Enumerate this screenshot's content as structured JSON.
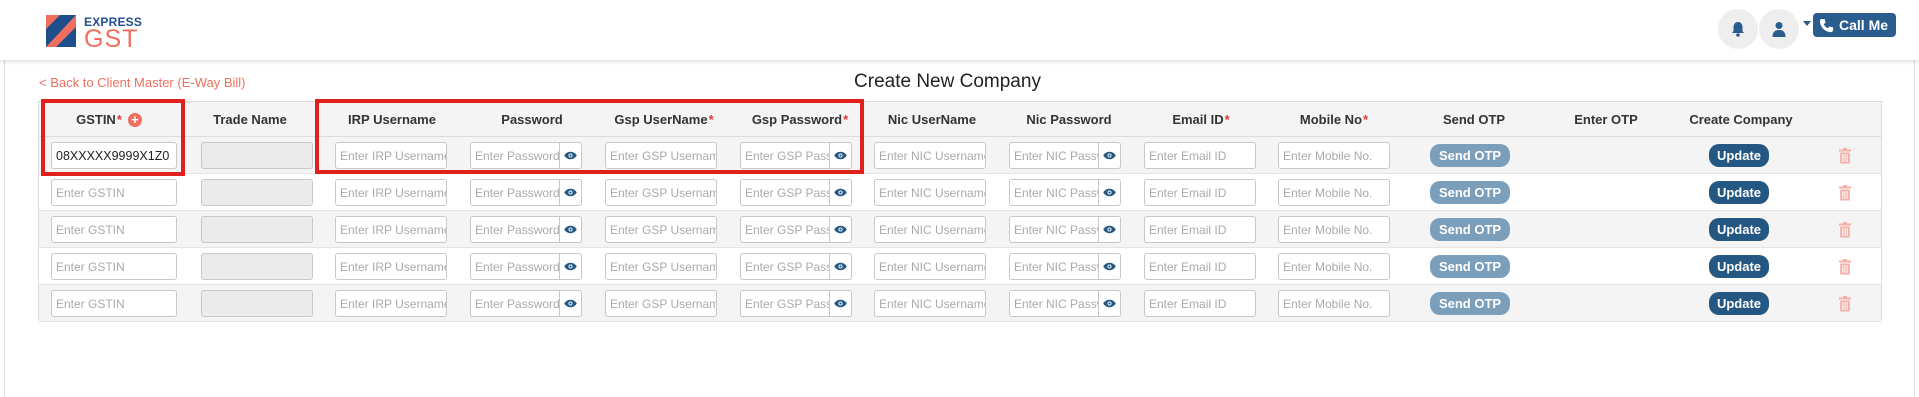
{
  "header": {
    "logo_top": "EXPRESS",
    "logo_bottom": "GST",
    "call_me_label": "Call Me"
  },
  "page": {
    "back_link": "< Back to Client Master (E-Way Bill)",
    "title": "Create New Company"
  },
  "table": {
    "columns": {
      "gstin": "GSTIN",
      "trade_name": "Trade Name",
      "irp_username": "IRP Username",
      "password": "Password",
      "gsp_username": "Gsp UserName",
      "gsp_password": "Gsp Password",
      "nic_username": "Nic UserName",
      "nic_password": "Nic Password",
      "email_id": "Email ID",
      "mobile_no": "Mobile No",
      "send_otp": "Send OTP",
      "enter_otp": "Enter OTP",
      "create_company": "Create Company"
    },
    "required_mark": "*",
    "add_icon_glyph": "+",
    "placeholders": {
      "gstin": "Enter GSTIN",
      "irp_username": "Enter IRP Username",
      "password": "Enter Password",
      "gsp_username": "Enter GSP Username",
      "gsp_password": "Enter GSP Password",
      "nic_username": "Enter NIC Username",
      "nic_password": "Enter NIC Password",
      "email_id": "Enter Email ID",
      "mobile_no": "Enter Mobile No."
    },
    "send_otp_label": "Send OTP",
    "update_label": "Update",
    "rows": [
      {
        "gstin": "08XXXXX9999X1Z0"
      },
      {
        "gstin": ""
      },
      {
        "gstin": ""
      },
      {
        "gstin": ""
      },
      {
        "gstin": ""
      }
    ]
  },
  "colors": {
    "accent": "#ef6f5e",
    "brand": "#245883",
    "highlight": "#e0201c"
  }
}
